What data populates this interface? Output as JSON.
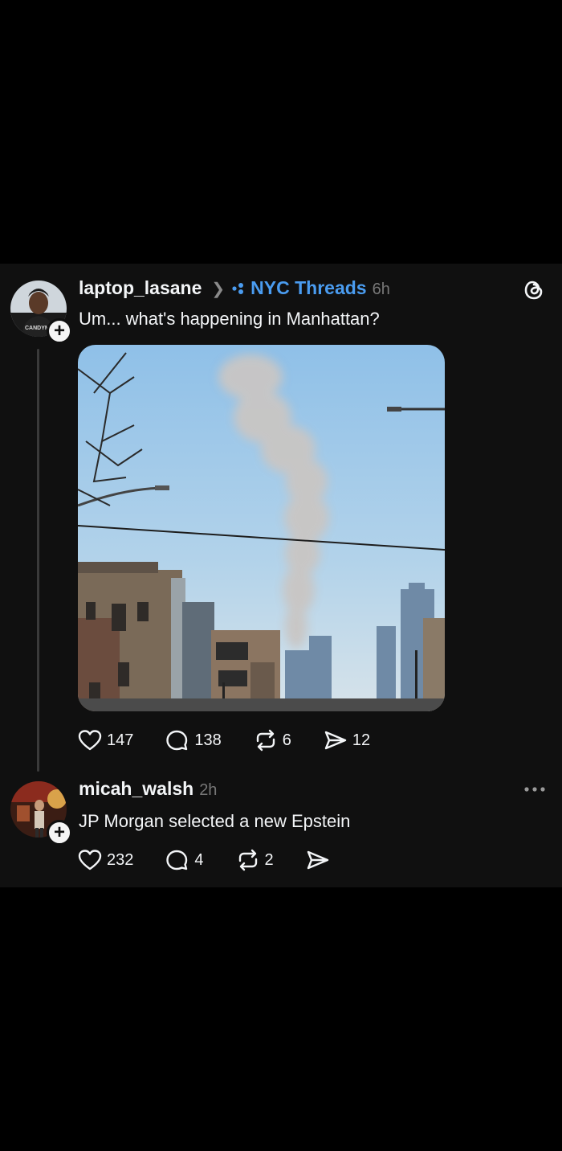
{
  "post": {
    "username": "laptop_lasane",
    "community": "NYC Threads",
    "time": "6h",
    "text": "Um... what's happening in Manhattan?",
    "avatar_shirt_text": "CANDYM",
    "likes": "147",
    "replies": "138",
    "reposts": "6",
    "shares": "12"
  },
  "reply": {
    "username": "micah_walsh",
    "time": "2h",
    "text": "JP Morgan selected a new Epstein",
    "likes": "232",
    "replies": "4",
    "reposts": "2"
  },
  "icons": {
    "app_logo": "threads-logo-icon",
    "community": "community-dots-icon",
    "follow": "plus-icon",
    "more": "more-options-icon"
  },
  "colors": {
    "background": "#101010",
    "community_link": "#4a9cf0",
    "muted": "#777777"
  }
}
